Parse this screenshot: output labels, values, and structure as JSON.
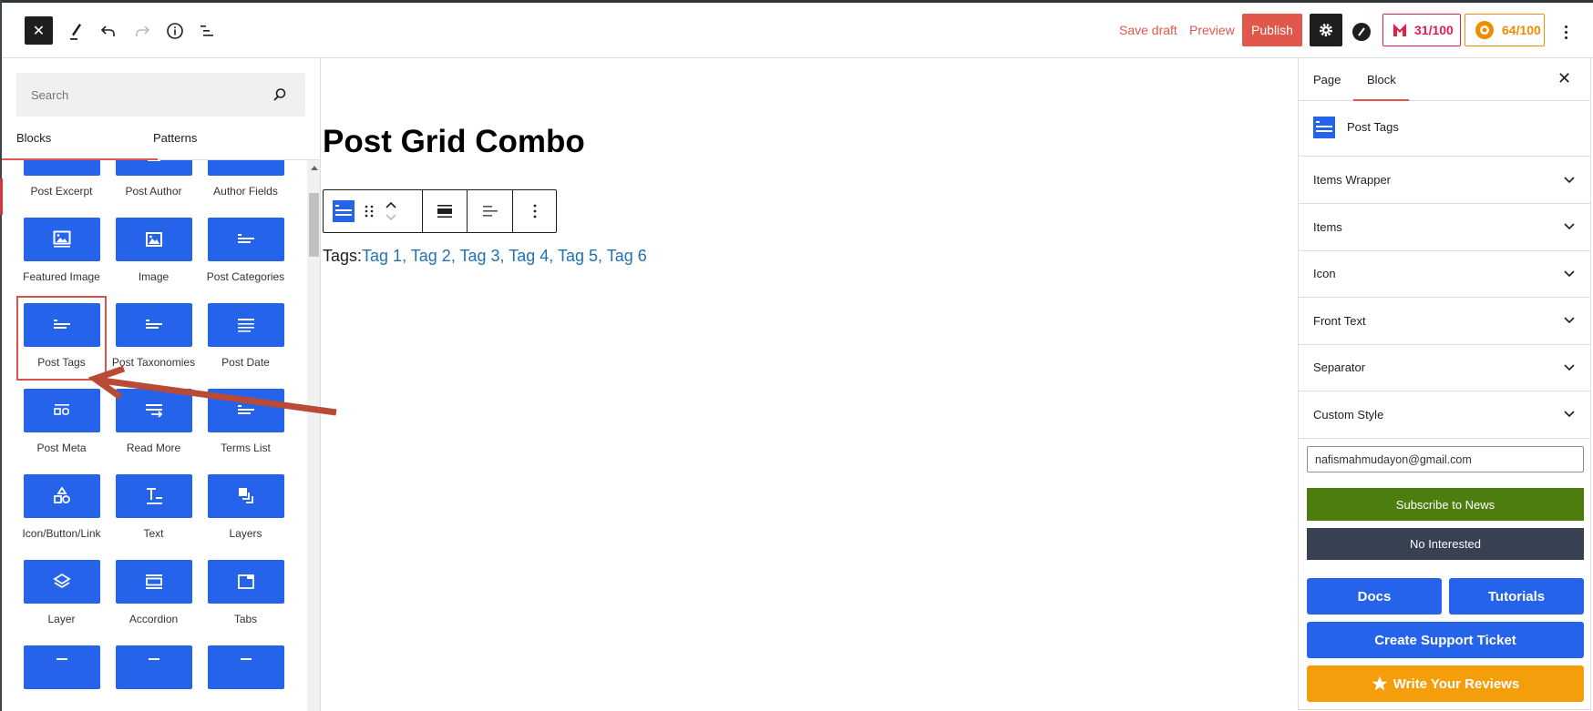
{
  "topbar": {
    "save_draft": "Save draft",
    "preview": "Preview",
    "publish": "Publish",
    "score_red": "31/100",
    "score_orange": "64/100"
  },
  "inserter": {
    "search_placeholder": "Search",
    "tabs": [
      "Blocks",
      "Patterns"
    ],
    "blocks": [
      {
        "label": "Post Excerpt",
        "icon": "text-icon"
      },
      {
        "label": "Post Author",
        "icon": "author-icon"
      },
      {
        "label": "Author Fields",
        "icon": "author-fields-icon"
      },
      {
        "label": "Featured Image",
        "icon": "featured-image-icon"
      },
      {
        "label": "Image",
        "icon": "image-icon"
      },
      {
        "label": "Post Categories",
        "icon": "terms-icon"
      },
      {
        "label": "Post Tags",
        "icon": "terms-icon"
      },
      {
        "label": "Post Taxonomies",
        "icon": "terms-icon"
      },
      {
        "label": "Post Date",
        "icon": "lines-icon"
      },
      {
        "label": "Post Meta",
        "icon": "meta-icon"
      },
      {
        "label": "Read More",
        "icon": "read-more-icon"
      },
      {
        "label": "Terms List",
        "icon": "terms-icon"
      },
      {
        "label": "Icon/Button/Link",
        "icon": "shapes-icon"
      },
      {
        "label": "Text",
        "icon": "text-t-icon"
      },
      {
        "label": "Layers",
        "icon": "layers-icon"
      },
      {
        "label": "Layer",
        "icon": "layer-icon"
      },
      {
        "label": "Accordion",
        "icon": "accordion-icon"
      },
      {
        "label": "Tabs",
        "icon": "tabs-icon"
      },
      {
        "label": "",
        "icon": "block-icon"
      },
      {
        "label": "",
        "icon": "block-icon"
      },
      {
        "label": "",
        "icon": "block-icon"
      }
    ]
  },
  "canvas": {
    "title": "Post Grid Combo",
    "tags_prefix": "Tags:",
    "tags": [
      "Tag 1",
      "Tag 2",
      "Tag 3",
      "Tag 4",
      "Tag 5",
      "Tag 6"
    ]
  },
  "sidebar": {
    "tabs": [
      "Page",
      "Block"
    ],
    "block_name": "Post Tags",
    "sections": [
      "Items Wrapper",
      "Items",
      "Icon",
      "Front Text",
      "Separator",
      "Custom Style"
    ],
    "email_value": "nafismahmudayon@gmail.com",
    "subscribe": "Subscribe to News",
    "not_interested": "No Interested",
    "docs": "Docs",
    "tutorials": "Tutorials",
    "support": "Create Support Ticket",
    "reviews": "Write Your Reviews"
  },
  "colors": {
    "accent": "#2563eb",
    "publish": "#e2574c",
    "subscribe": "#4d7c0f",
    "dark": "#374151",
    "review": "#f59e0b"
  }
}
